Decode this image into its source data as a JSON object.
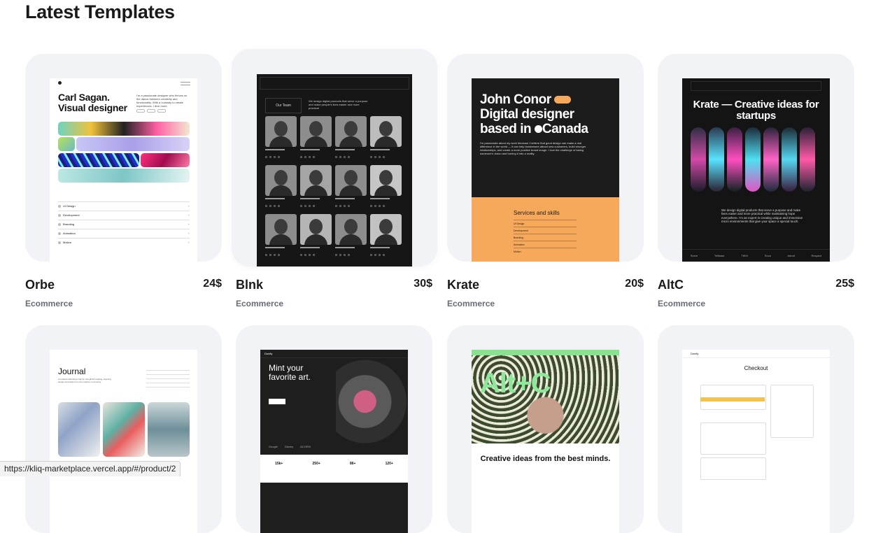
{
  "page": {
    "title": "Latest Templates"
  },
  "templates": [
    {
      "name": "Orbe",
      "price": "24$",
      "category": "Ecommerce"
    },
    {
      "name": "Blnk",
      "price": "30$",
      "category": "Ecommerce"
    },
    {
      "name": "Krate",
      "price": "20$",
      "category": "Ecommerce"
    },
    {
      "name": "AltC",
      "price": "25$",
      "category": "Ecommerce"
    }
  ],
  "previews": {
    "orbe": {
      "headline": "Carl Sagan. Visual designer",
      "bio": "I'm a passionate designer who thrives on the dance between creativity and functionality. With a curiosity to create experiences, I dive more.",
      "services": [
        "UI Design",
        "Development",
        "Branding",
        "Animation",
        "Motion"
      ]
    },
    "blnk": {
      "button": "Our Team",
      "text": "We design digital products that serve a purpose and make people's lives easier and more practical"
    },
    "krate": {
      "line1": "John Conor",
      "line2": "Digital designer",
      "line3a": "based in",
      "line3b": "Canada",
      "para": "I'm passionate about my work because I believe that good design can make a real difference in the world — it can help businesses attract new customers, build stronger relationships, and create a more positive brand image. I love the challenge of taking someone's vision and turning it into a reality.",
      "skills_title": "Services and skills",
      "skills": [
        "UI Design",
        "Development",
        "Branding",
        "Animation",
        "Motion"
      ]
    },
    "altc": {
      "headline": "Krate — Creative ideas for startups",
      "para": "We design digital products that serve a purpose and make lives easier and more practical while maintaining hope everywhere. I'm an expert in creating unique and immersive micro environments that give your space a special touch.",
      "logos": [
        "Serve",
        "Tellbase",
        "TIKKI",
        "Sova",
        "Adroit",
        "Respect"
      ]
    },
    "journal": {
      "title": "Journal",
      "text": "A curated editorial journal for thoughtful reading, inspiring design and ideas from the creative community."
    },
    "mint": {
      "brand": "Donfly",
      "headline": "Mint your favorite art.",
      "stats": [
        "15k+",
        "250+",
        "86+",
        "120+"
      ],
      "partners": [
        "Google",
        "Disney",
        "ACORN"
      ]
    },
    "altc2": {
      "logo": "Alt+C",
      "sub": "Creative ideas from the best minds."
    },
    "checkout": {
      "brand": "Donfly",
      "title": "Checkout"
    }
  },
  "status_bar": {
    "url": "https://kliq-marketplace.vercel.app/#/product/2"
  }
}
